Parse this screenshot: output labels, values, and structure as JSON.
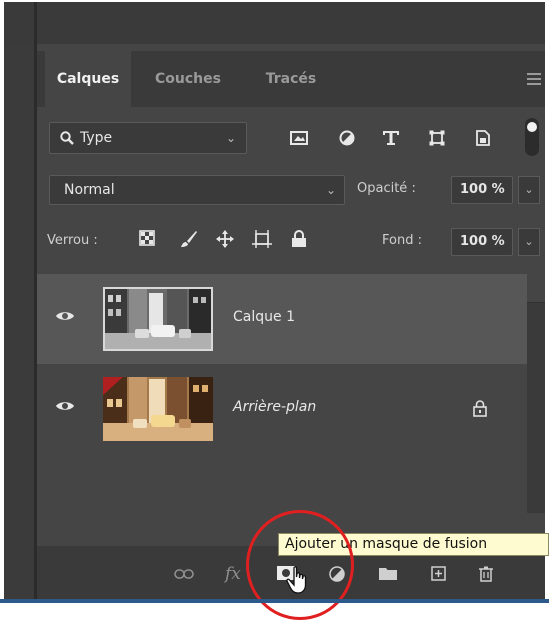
{
  "tabs": [
    {
      "label": "Calques",
      "active": true
    },
    {
      "label": "Couches",
      "active": false
    },
    {
      "label": "Tracés",
      "active": false
    }
  ],
  "filter": {
    "label": "Type",
    "icon": "search-icon"
  },
  "filter_icons": [
    "image-filter-icon",
    "adjustment-filter-icon",
    "type-filter-icon",
    "shape-filter-icon",
    "smart-object-filter-icon"
  ],
  "blend": {
    "mode": "Normal",
    "opacity_label": "Opacité :",
    "opacity_value": "100 %"
  },
  "lock": {
    "label": "Verrou :",
    "fill_label": "Fond :",
    "fill_value": "100 %"
  },
  "layers": [
    {
      "name": "Calque 1",
      "visible": true,
      "selected": true
    },
    {
      "name": "Arrière-plan",
      "visible": true,
      "selected": false,
      "locked": true
    }
  ],
  "tooltip": "Ajouter un masque de fusion",
  "colors": {
    "panel": "#454545",
    "selected_layer": "#575757",
    "tooltip_bg": "#fffbd0",
    "highlight": "#e02020"
  }
}
